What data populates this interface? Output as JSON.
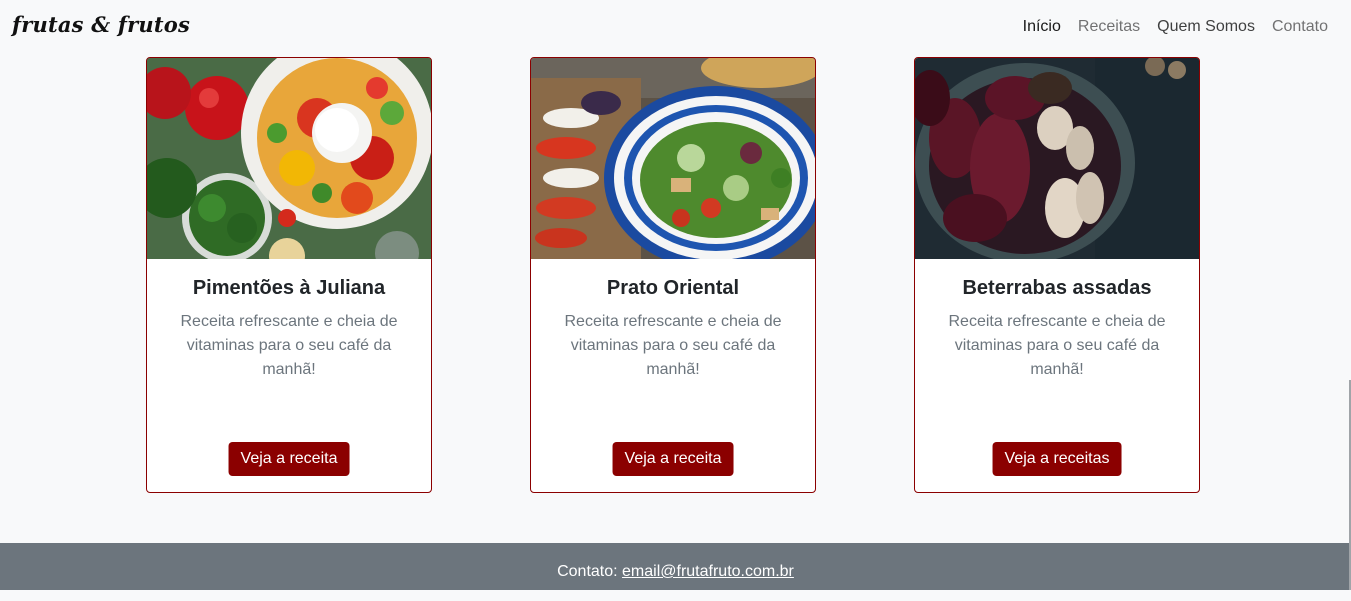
{
  "navbar": {
    "brand": "frutas & frutos",
    "items": [
      {
        "label": "Início"
      },
      {
        "label": "Receitas"
      },
      {
        "label": "Quem Somos"
      },
      {
        "label": "Contato"
      }
    ]
  },
  "cards": [
    {
      "title": "Pimentões à Juliana",
      "text": "Receita refrescante e cheia de vitaminas para o seu café da manhã!",
      "button": "Veja a receita"
    },
    {
      "title": "Prato Oriental",
      "text": "Receita refrescante e cheia de vitaminas para o seu café da manhã!",
      "button": "Veja a receita"
    },
    {
      "title": "Beterrabas assadas",
      "text": "Receita refrescante e cheia de vitaminas para o seu café da manhã!",
      "button": "Veja a receitas"
    }
  ],
  "footer": {
    "label": "Contato:",
    "email": "email@frutafruto.com.br"
  },
  "colors": {
    "accent": "#8b0000",
    "footer_bg": "#6c757d",
    "page_bg": "#f8f9fa"
  }
}
